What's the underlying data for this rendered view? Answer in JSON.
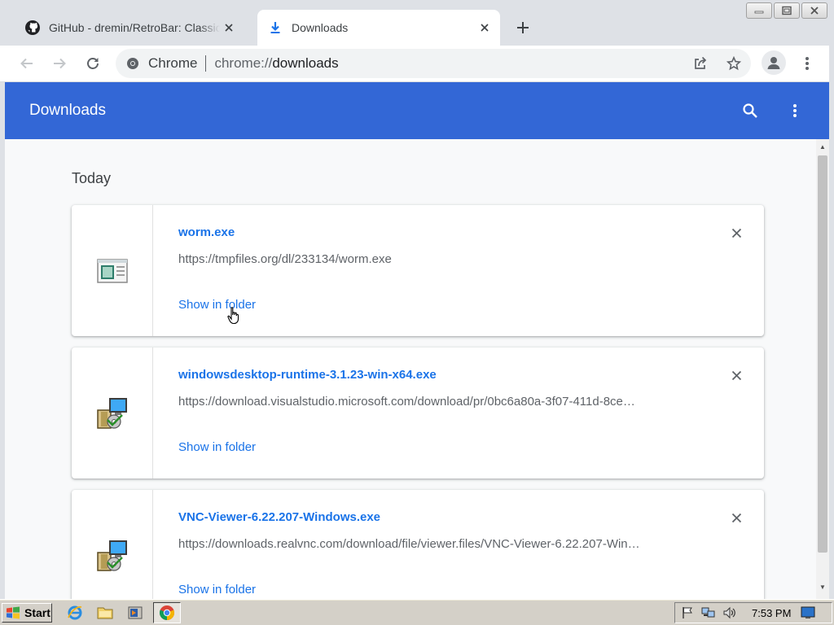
{
  "tabs": [
    {
      "title": "GitHub - dremin/RetroBar: Classic Windows",
      "icon": "github-icon",
      "active": false
    },
    {
      "title": "Downloads",
      "icon": "download-icon",
      "active": true
    }
  ],
  "omnibox": {
    "label": "Chrome",
    "url_scheme": "chrome://",
    "url_host": "downloads"
  },
  "page": {
    "title": "Downloads",
    "section": "Today"
  },
  "downloads": [
    {
      "name": "worm.exe",
      "url": "https://tmpfiles.org/dl/233134/worm.exe",
      "action": "Show in folder",
      "icon": "executable-file-icon"
    },
    {
      "name": "windowsdesktop-runtime-3.1.23-win-x64.exe",
      "url": "https://download.visualstudio.microsoft.com/download/pr/0bc6a80a-3f07-411d-8ce…",
      "action": "Show in folder",
      "icon": "installer-icon"
    },
    {
      "name": "VNC-Viewer-6.22.207-Windows.exe",
      "url": "https://downloads.realvnc.com/download/file/viewer.files/VNC-Viewer-6.22.207-Win…",
      "action": "Show in folder",
      "icon": "installer-icon"
    }
  ],
  "taskbar": {
    "start_label": "Start",
    "clock": "7:53 PM"
  },
  "colors": {
    "header": "#3367d6",
    "link": "#1a73e8",
    "tabstrip": "#dee1e6",
    "taskbar": "#d4d0c8"
  }
}
